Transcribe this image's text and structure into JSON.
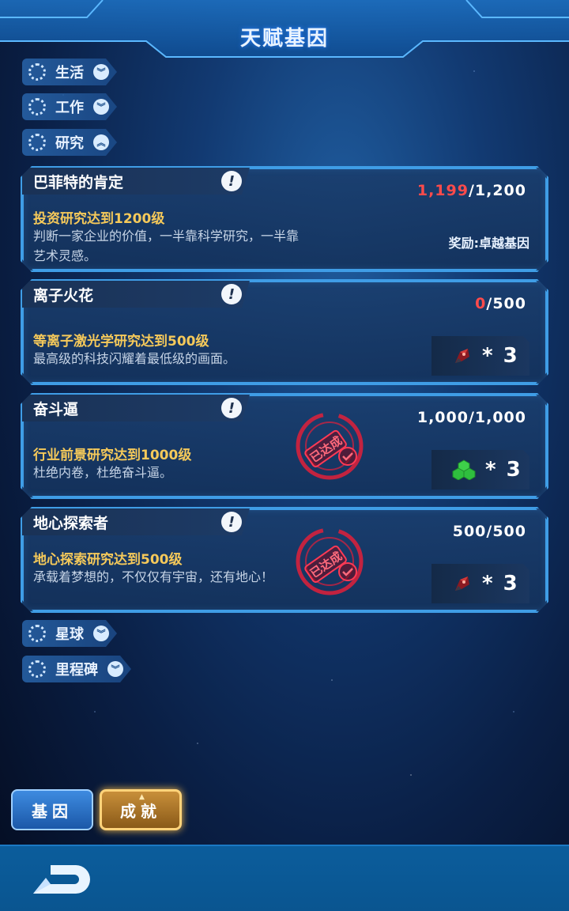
{
  "header": {
    "title": "天赋基因"
  },
  "categories": {
    "life": {
      "label": "生活"
    },
    "work": {
      "label": "工作"
    },
    "research": {
      "label": "研究"
    },
    "planet": {
      "label": "星球"
    },
    "milestone": {
      "label": "里程碑"
    }
  },
  "cards": [
    {
      "title": "巴菲特的肯定",
      "requirement": "投资研究达到1200级",
      "description": "判断一家企业的价值，一半靠科学研究，一半靠艺术灵感。",
      "progress_current": "1,199",
      "progress_total": "/1,200",
      "reward_text": "奖励:卓越基因",
      "achieved": false
    },
    {
      "title": "离子火花",
      "requirement": "等离子激光学研究达到500级",
      "description": "最高级的科技闪耀着最低级的画面。",
      "progress_current": "0",
      "progress_total": "/500",
      "reward_icon": "rocket-ship-icon",
      "reward_count": "* 3",
      "achieved": false
    },
    {
      "title": "奋斗逼",
      "requirement": "行业前景研究达到1000级",
      "description": "杜绝内卷，杜绝奋斗逼。",
      "progress_current": "1,000",
      "progress_total": "/1,000",
      "reward_icon": "green-gem-cluster-icon",
      "reward_count": "* 3",
      "achieved": true,
      "stamp_text": "已达成"
    },
    {
      "title": "地心探索者",
      "requirement": "地心探索研究达到500级",
      "description": "承载着梦想的，不仅仅有宇宙，还有地心！",
      "progress_current": "500",
      "progress_total": "/500",
      "reward_icon": "rocket-ship-icon",
      "reward_count": "* 3",
      "achieved": true,
      "stamp_text": "已达成"
    }
  ],
  "tabs": {
    "gene": "基因",
    "achievement": "成就"
  },
  "colors": {
    "accent_border": "#3f9de6",
    "requirement_text": "#f5c95a",
    "progress_red": "#ff4b4b",
    "stamp_red": "#e0203a"
  }
}
